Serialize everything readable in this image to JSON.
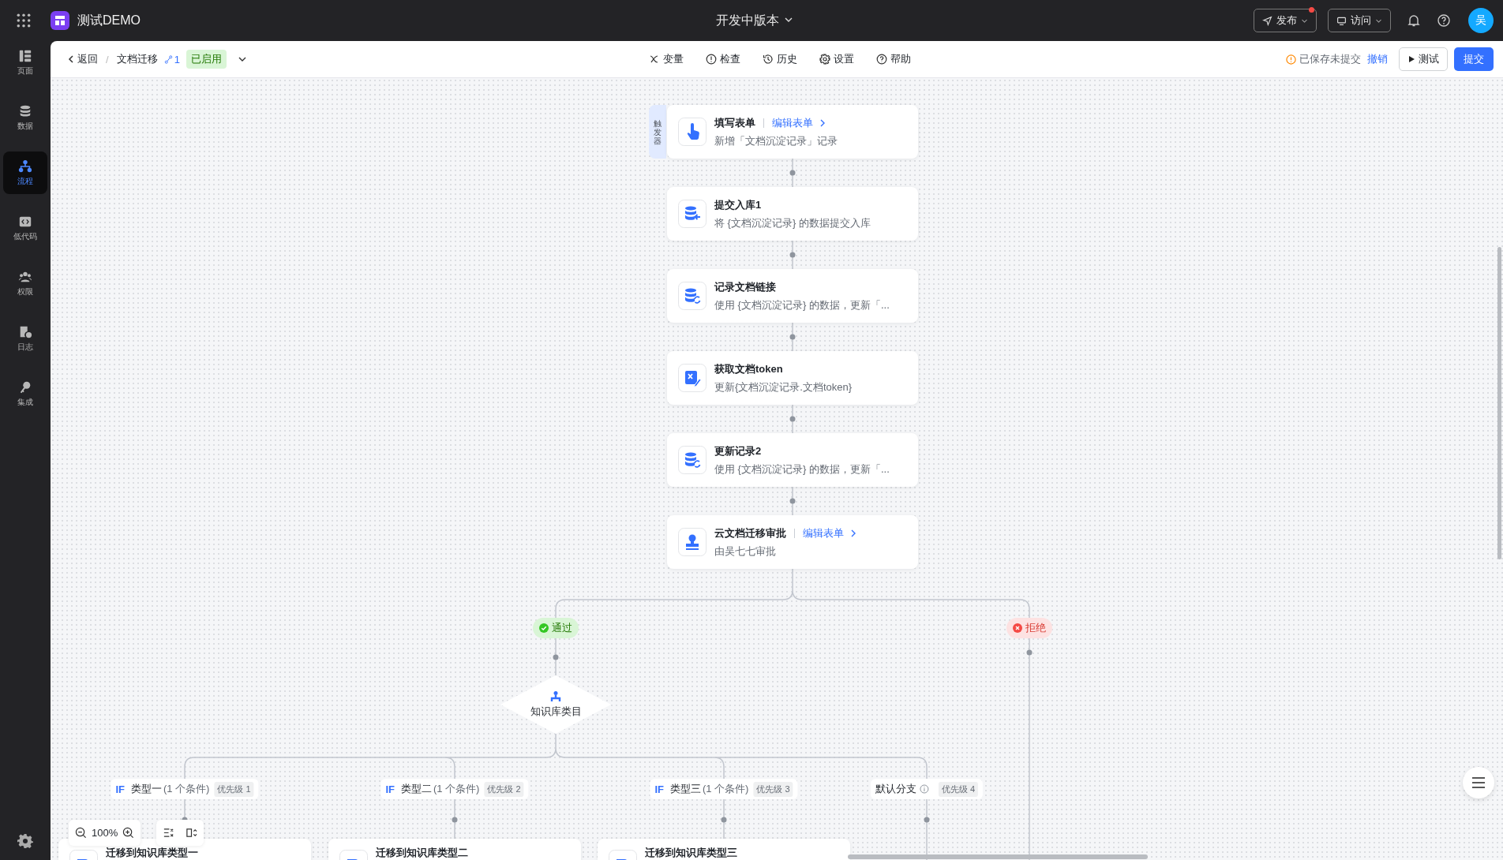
{
  "app": {
    "title": "测试DEMO",
    "version": "开发中版本",
    "publish": "发布",
    "publish_badge": true,
    "visit": "访问",
    "avatar": "吴"
  },
  "sidebar": {
    "items": [
      {
        "kind": "page",
        "label": "页面",
        "selected": false
      },
      {
        "kind": "data",
        "label": "数据",
        "selected": false
      },
      {
        "kind": "flow",
        "label": "流程",
        "selected": true
      },
      {
        "kind": "code",
        "label": "低代码",
        "selected": false
      },
      {
        "kind": "users",
        "label": "权限",
        "selected": false
      },
      {
        "kind": "log",
        "label": "日志",
        "selected": false
      },
      {
        "kind": "key",
        "label": "集成",
        "selected": false
      }
    ]
  },
  "toolbar": {
    "back": "返回",
    "separator": "/",
    "flow_name": "文档迁移",
    "version_count": "1",
    "status": "已启用",
    "actions": [
      {
        "kind": "variable",
        "label": "变量"
      },
      {
        "kind": "check",
        "label": "检查"
      },
      {
        "kind": "history",
        "label": "历史"
      },
      {
        "kind": "settings",
        "label": "设置"
      },
      {
        "kind": "help",
        "label": "帮助"
      }
    ],
    "save_status": "已保存未提交",
    "undo": "撤销",
    "test": "测试",
    "submit": "提交"
  },
  "flow": {
    "trigger_label": "触发器",
    "nodes": [
      {
        "kind": "form",
        "title": "填写表单",
        "link": "编辑表单",
        "desc": "新增「文档沉淀记录」记录"
      },
      {
        "kind": "insert",
        "title": "提交入库1",
        "desc": "将 {文档沉淀记录} 的数据提交入库"
      },
      {
        "kind": "update",
        "title": "记录文档链接",
        "desc": "使用 {文档沉淀记录} 的数据，更新「..."
      },
      {
        "kind": "script",
        "title": "获取文档token",
        "desc": "更新{文档沉淀记录.文档token}"
      },
      {
        "kind": "update",
        "title": "更新记录2",
        "desc": "使用 {文档沉淀记录} 的数据，更新「..."
      },
      {
        "kind": "approval",
        "title": "云文档迁移审批",
        "link": "编辑表单",
        "desc": "由吴七七审批"
      }
    ],
    "outcomes": [
      {
        "kind": "pass",
        "label": "通过"
      },
      {
        "kind": "reject",
        "label": "拒绝"
      }
    ],
    "gateway": {
      "label": "知识库类目"
    },
    "branches": [
      {
        "kind": "if",
        "prefix": "IF",
        "name": "类型一",
        "conditions": "(1 个条件)",
        "priority": "优先级 1",
        "card": "迁移到知识库类型一"
      },
      {
        "kind": "if",
        "prefix": "IF",
        "name": "类型二",
        "conditions": "(1 个条件)",
        "priority": "优先级 2",
        "card": "迁移到知识库类型二"
      },
      {
        "kind": "if",
        "prefix": "IF",
        "name": "类型三",
        "conditions": "(1 个条件)",
        "priority": "优先级 3",
        "card": "迁移到知识库类型三"
      },
      {
        "kind": "default",
        "name": "默认分支",
        "priority": "优先级 4"
      }
    ]
  },
  "zoom": {
    "percent": "100%"
  }
}
